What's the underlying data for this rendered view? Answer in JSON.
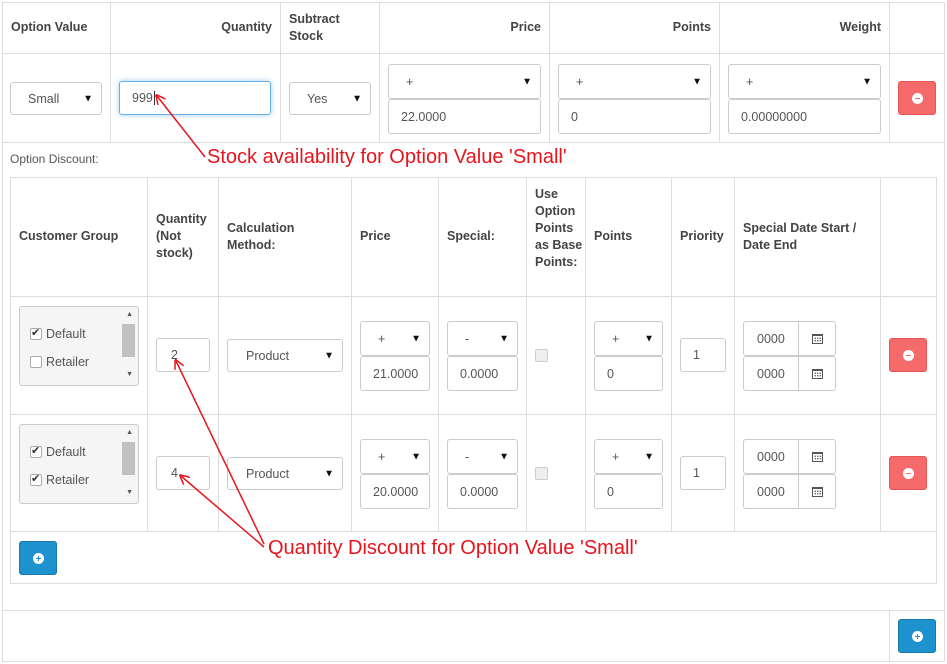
{
  "option_table": {
    "headers": {
      "option_value": "Option Value",
      "quantity": "Quantity",
      "subtract_stock": "Subtract Stock",
      "price": "Price",
      "points": "Points",
      "weight": "Weight"
    },
    "row": {
      "option_value": "Small",
      "quantity": "999",
      "subtract": "Yes",
      "price_prefix": "+",
      "price": "22.0000",
      "points_prefix": "+",
      "points": "0",
      "weight_prefix": "+",
      "weight": "0.00000000"
    }
  },
  "discount": {
    "label": "Option Discount:",
    "headers": {
      "customer_group": "Customer Group",
      "quantity": "Quantity (Not stock)",
      "calc_method": "Calculation Method:",
      "price": "Price",
      "special": "Special:",
      "use_option_points": "Use Option Points as Base Points:",
      "points": "Points",
      "priority": "Priority",
      "special_date": "Special Date Start / Date End"
    },
    "rows": [
      {
        "groups": [
          {
            "label": "Default",
            "checked": true
          },
          {
            "label": "Retailer",
            "checked": false
          }
        ],
        "quantity": "2",
        "calc_method": "Product",
        "price_prefix": "+",
        "price": "21.0000",
        "special_prefix": "-",
        "special": "0.0000",
        "use_option_points": false,
        "points_prefix": "+",
        "points": "0",
        "priority": "1",
        "date_start": "0000",
        "date_end": "0000"
      },
      {
        "groups": [
          {
            "label": "Default",
            "checked": true
          },
          {
            "label": "Retailer",
            "checked": true
          }
        ],
        "quantity": "4",
        "calc_method": "Product",
        "price_prefix": "+",
        "price": "20.0000",
        "special_prefix": "-",
        "special": "0.0000",
        "use_option_points": false,
        "points_prefix": "+",
        "points": "0",
        "priority": "1",
        "date_start": "0000",
        "date_end": "0000"
      }
    ]
  },
  "icons": {
    "remove": "minus-circle-icon",
    "add": "plus-circle-icon",
    "calendar": "calendar-icon",
    "dropdown": "caret-down-icon"
  },
  "colors": {
    "danger": "#f56b6b",
    "primary": "#1e91cf",
    "annotation": "#e8141c"
  },
  "annotations": {
    "stock": "Stock availability for Option Value 'Small'",
    "discount": "Quantity Discount for Option Value 'Small'"
  }
}
